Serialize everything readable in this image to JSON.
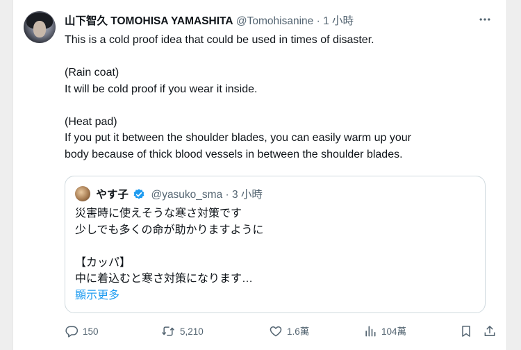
{
  "tweet": {
    "display_name": "山下智久 TOMOHISA YAMASHITA",
    "handle": "@Tomohisanine",
    "separator": "·",
    "time": "1 小時",
    "lines": [
      "This is a cold proof idea that could be used in times of disaster.",
      "",
      "(Rain coat)",
      "It will be cold proof if you wear it inside.",
      "",
      "(Heat pad)",
      "If you put it between the shoulder blades, you can easily warm up your",
      "body because of thick blood vessels in between the shoulder blades."
    ]
  },
  "quoted": {
    "display_name": "やす子",
    "handle": "@yasuko_sma",
    "separator": "·",
    "time": "3 小時",
    "lines": [
      "災害時に使えそうな寒さ対策です",
      "少しでも多くの命が助かりますように",
      "",
      "【カッパ】",
      "中に着込むと寒さ対策になります…"
    ],
    "show_more": "顯示更多"
  },
  "actions": {
    "replies": "150",
    "reposts": "5,210",
    "likes": "1.6萬",
    "views": "104萬"
  },
  "icons": {
    "more": "more-horizontal-icon",
    "verified": "verified-badge-icon",
    "reply": "reply-icon",
    "repost": "repost-icon",
    "like": "heart-icon",
    "views": "analytics-icon",
    "bookmark": "bookmark-icon",
    "share": "share-icon"
  },
  "colors": {
    "accent": "#1d9bf0",
    "secondary_text": "#536471",
    "border": "#cfd9de"
  }
}
